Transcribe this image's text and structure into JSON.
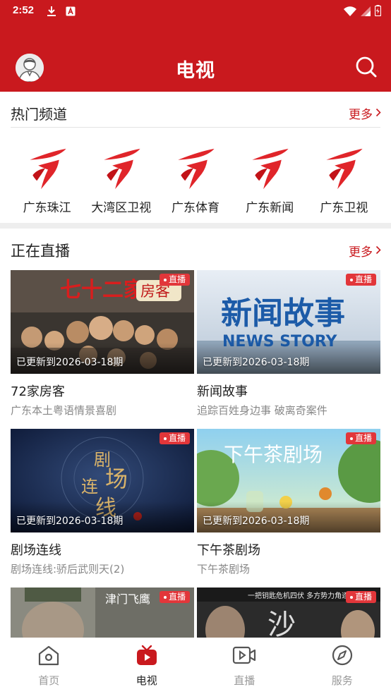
{
  "status": {
    "time": "2:52"
  },
  "header": {
    "title": "电视"
  },
  "hot_channels": {
    "title": "热门频道",
    "more": "更多",
    "items": [
      {
        "name": "广东珠江"
      },
      {
        "name": "大湾区卫视"
      },
      {
        "name": "广东体育"
      },
      {
        "name": "广东新闻"
      },
      {
        "name": "广东卫视"
      }
    ]
  },
  "live": {
    "title": "正在直播",
    "more": "更多",
    "badge": "直播",
    "cards": [
      {
        "title": "72家房客",
        "subtitle": "广东本土粤语情景喜剧",
        "updated": "已更新到2026-03-18期",
        "thumb_text": "七十二家房客"
      },
      {
        "title": "新闻故事",
        "subtitle": "追踪百姓身边事 破离奇案件",
        "updated": "已更新到2026-03-18期",
        "thumb_text": "新闻故事",
        "thumb_text_en": "NEWS STORY"
      },
      {
        "title": "剧场连线",
        "subtitle": "剧场连线:骄后武则天(2)",
        "updated": "已更新到2026-03-18期",
        "thumb_text": "剧场连线"
      },
      {
        "title": "下午茶剧场",
        "subtitle": "下午茶剧场",
        "updated": "已更新到2026-03-18期",
        "thumb_text": "下午茶剧场"
      },
      {
        "title": "",
        "subtitle": "",
        "updated": "",
        "thumb_text": "津门飞鹰"
      },
      {
        "title": "",
        "subtitle": "",
        "updated": "",
        "thumb_text": "一把钥匙危机四伏 多方势力角逐"
      }
    ]
  },
  "nav": {
    "items": [
      {
        "label": "首页",
        "icon": "home-icon",
        "active": false
      },
      {
        "label": "电视",
        "icon": "tv-icon",
        "active": true
      },
      {
        "label": "直播",
        "icon": "live-video-icon",
        "active": false
      },
      {
        "label": "服务",
        "icon": "compass-icon",
        "active": false
      }
    ]
  },
  "colors": {
    "brand": "#c9191e",
    "badge": "#e2363a",
    "muted": "#999999"
  }
}
